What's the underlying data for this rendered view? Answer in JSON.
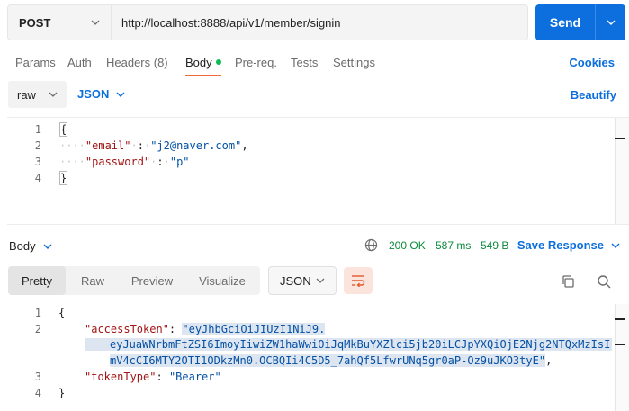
{
  "request": {
    "method": "POST",
    "url": "http://localhost:8888/api/v1/member/signin",
    "send_label": "Send"
  },
  "tabs": {
    "params": "Params",
    "auth": "Auth",
    "headers": "Headers (8)",
    "body": "Body",
    "prereq": "Pre-req.",
    "tests": "Tests",
    "settings": "Settings",
    "cookies": "Cookies"
  },
  "body_options": {
    "type": "raw",
    "format": "JSON",
    "beautify": "Beautify"
  },
  "request_body": {
    "line_numbers": [
      "1",
      "2",
      "3",
      "4"
    ],
    "open": "{",
    "email_key": "\"email\"",
    "email_value": "\"j2@naver.com\"",
    "password_key": "\"password\"",
    "password_value": "\"p\"",
    "close": "}"
  },
  "response": {
    "label": "Body",
    "status": "200 OK",
    "time": "587 ms",
    "size": "549 B",
    "save": "Save Response",
    "views": [
      "Pretty",
      "Raw",
      "Preview",
      "Visualize"
    ],
    "format": "JSON",
    "line_numbers": [
      "1",
      "2",
      "3",
      "4"
    ],
    "open": "{",
    "access_key": "\"accessToken\"",
    "token_part1": "\"eyJhbGciOiJIUzI1NiJ9.",
    "token_part2": "eyJuaWNrbmFtZSI6ImoyIiwiZW1haWwiOiJqMkBuYXZlci5jb20iLCJpYXQiOjE2Njg2NTQxMzIsI",
    "token_part3": "mV4cCI6MTY2OTI1ODkzMn0.OCBQIi4C5D5_7ahQf5LfwrUNq5gr0aP-Oz9uJKO3tyE\"",
    "type_key": "\"tokenType\"",
    "type_value": "\"Bearer\"",
    "close": "}"
  },
  "colors": {
    "accent": "#0c6fdd",
    "active_tab": "#f26b3a",
    "status_ok": "#0c8a3c"
  }
}
